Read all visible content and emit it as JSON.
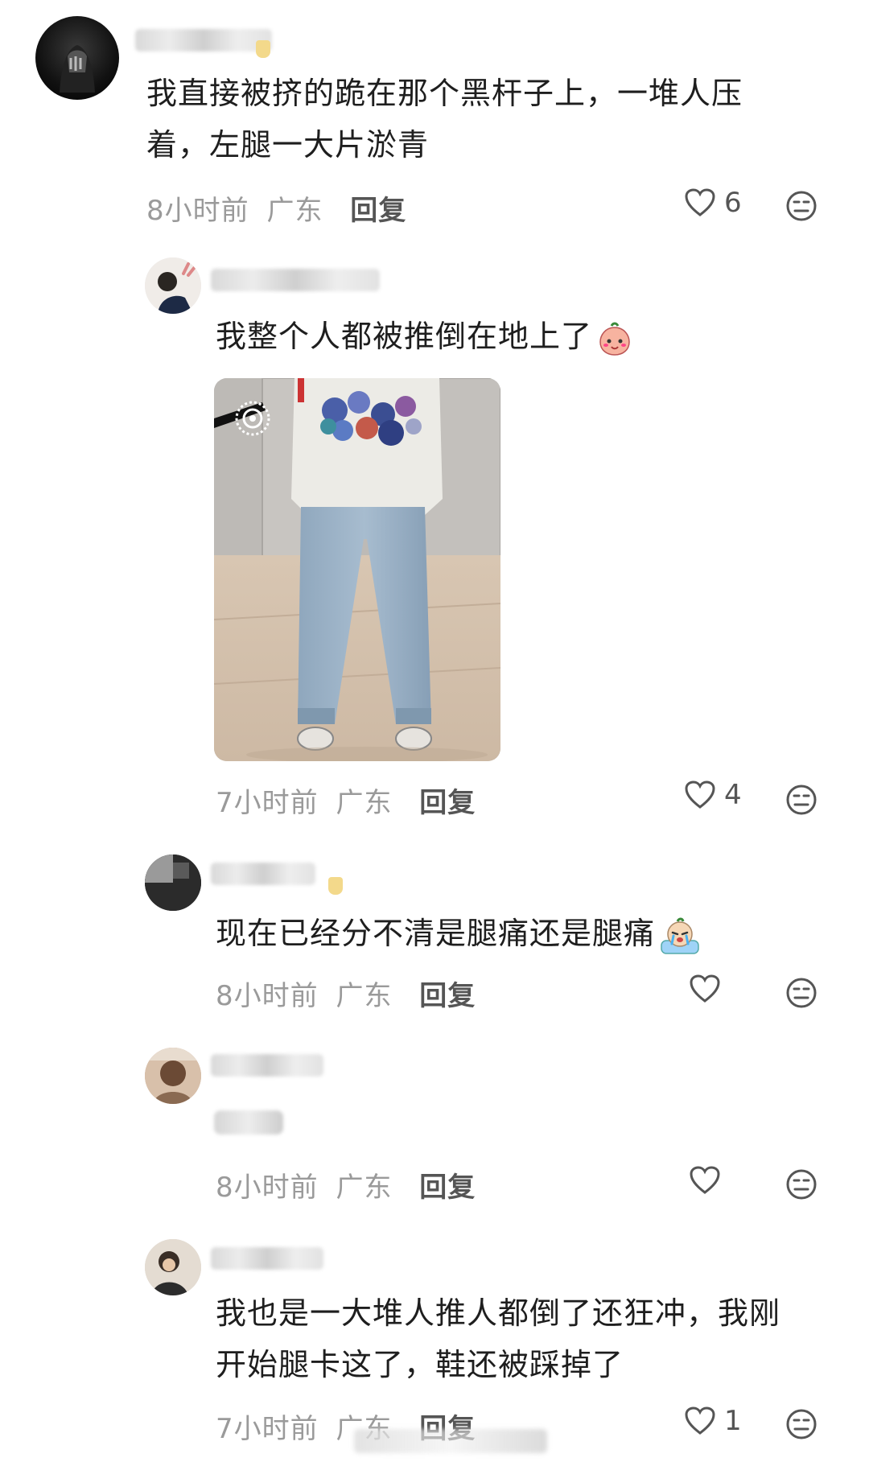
{
  "comments": [
    {
      "text_line1": "我直接被挤的跪在那个黑杆子上，一堆人压",
      "text_line2": "着，左腿一大片淤青",
      "time": "8小时前",
      "location": "广东",
      "reply_label": "回复",
      "likes": "6"
    },
    {
      "text": "我整个人都被推倒在地上了",
      "time": "7小时前",
      "location": "广东",
      "reply_label": "回复",
      "likes": "4"
    },
    {
      "text": "现在已经分不清是腿痛还是腿痛",
      "time": "8小时前",
      "location": "广东",
      "reply_label": "回复",
      "likes": ""
    },
    {
      "time": "8小时前",
      "location": "广东",
      "reply_label": "回复",
      "likes": ""
    },
    {
      "text_line1": "我也是一大堆人推人都倒了还狂冲，我刚",
      "text_line2": "开始腿卡这了，鞋还被踩掉了",
      "time": "7小时前",
      "location": "广东",
      "reply_label": "回复",
      "likes": "1"
    }
  ],
  "icons": {
    "like": "heart-outline-icon",
    "dislike": "meh-face-icon"
  },
  "colors": {
    "meta_text": "#9a9a9a",
    "reply_text": "#555555",
    "body_text": "#1e1e1e"
  }
}
